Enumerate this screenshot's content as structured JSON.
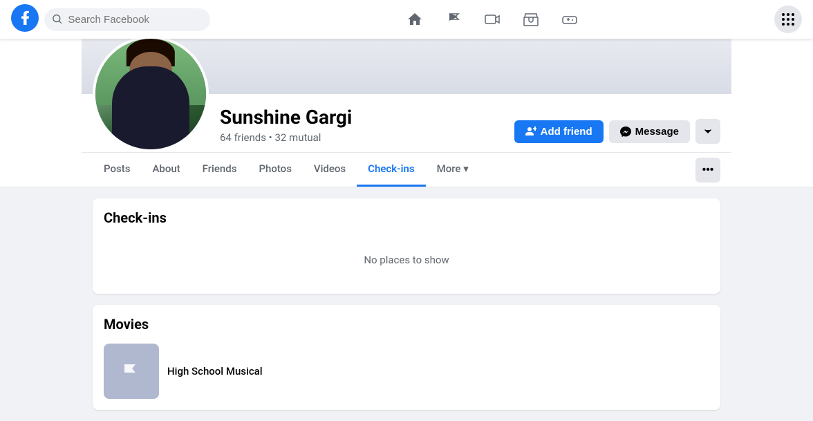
{
  "nav": {
    "search_placeholder": "Search Facebook",
    "logo_label": "Facebook",
    "icons": [
      {
        "name": "home-icon",
        "symbol": "⌂"
      },
      {
        "name": "flag-icon",
        "symbol": "⚑"
      },
      {
        "name": "play-icon",
        "symbol": "▶"
      },
      {
        "name": "store-icon",
        "symbol": "🏪"
      },
      {
        "name": "gamepad-icon",
        "symbol": "🎮"
      }
    ],
    "grid_icon": "⠿"
  },
  "profile": {
    "name": "Sunshine Gargi",
    "friends_count": "64 friends",
    "mutual_count": "32 mutual",
    "friends_label": "64 friends • 32 mutual",
    "add_friend_label": "Add friend",
    "message_label": "Message",
    "dropdown_label": "▾"
  },
  "tabs": [
    {
      "id": "posts",
      "label": "Posts",
      "active": false
    },
    {
      "id": "about",
      "label": "About",
      "active": false
    },
    {
      "id": "friends",
      "label": "Friends",
      "active": false
    },
    {
      "id": "photos",
      "label": "Photos",
      "active": false
    },
    {
      "id": "videos",
      "label": "Videos",
      "active": false
    },
    {
      "id": "checkins",
      "label": "Check-ins",
      "active": true
    },
    {
      "id": "more",
      "label": "More ▾",
      "active": false
    }
  ],
  "ellipsis_label": "•••",
  "sections": {
    "checkins": {
      "title": "Check-ins",
      "empty_message": "No places to show"
    },
    "movies": {
      "title": "Movies",
      "items": [
        {
          "name": "High School Musical"
        }
      ]
    }
  },
  "colors": {
    "accent": "#1877f2",
    "button_bg": "#e4e6eb",
    "text_primary": "#050505",
    "text_secondary": "#606770"
  }
}
